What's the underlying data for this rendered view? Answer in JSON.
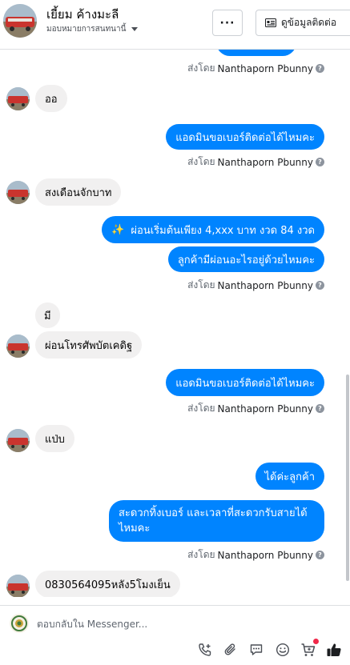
{
  "header": {
    "name": "เยี้ยม ค้างมะลี",
    "subtitle": "มอบหมายการสนทนานี้",
    "contact_button": "ดูข้อมูลติดต่อ"
  },
  "sent_by_prefix": "ส่งโดย",
  "agent_name": "Nanthaporn Pbunny",
  "messages": {
    "in1": "ออ",
    "out1": "แอดมินขอเบอร์ติดต่อได้ไหมคะ",
    "in2": "สงเดือนจักบาท",
    "out2_icon": "✨",
    "out2": "ผ่อนเริ่มต้นเพียง 4,xxx บาท งวด 84 งวด",
    "out3": "ลูกค้ามีผ่อนอะไรอยู่ด้วยไหมคะ",
    "in3a": "มี",
    "in3b": "ผ่อนโทรศัพบัตเคดิฐ",
    "out4": "แอดมินขอเบอร์ติดต่อได้ไหมคะ",
    "in4": "แป่บ",
    "out5": "ได้ค่ะลูกค้า",
    "out6_line1": "สะดวกทิ้งเบอร์ และเวลาที่สะดวกรับสายได้",
    "out6_line2": "ไหมคะ",
    "in5": "0830564095หลัง5โมงเย็น"
  },
  "composer": {
    "placeholder": "ตอบกลับใน Messenger..."
  },
  "colors": {
    "outgoing": "#0084ff",
    "incoming": "#f1f0f0",
    "like": "#1c1e21"
  }
}
